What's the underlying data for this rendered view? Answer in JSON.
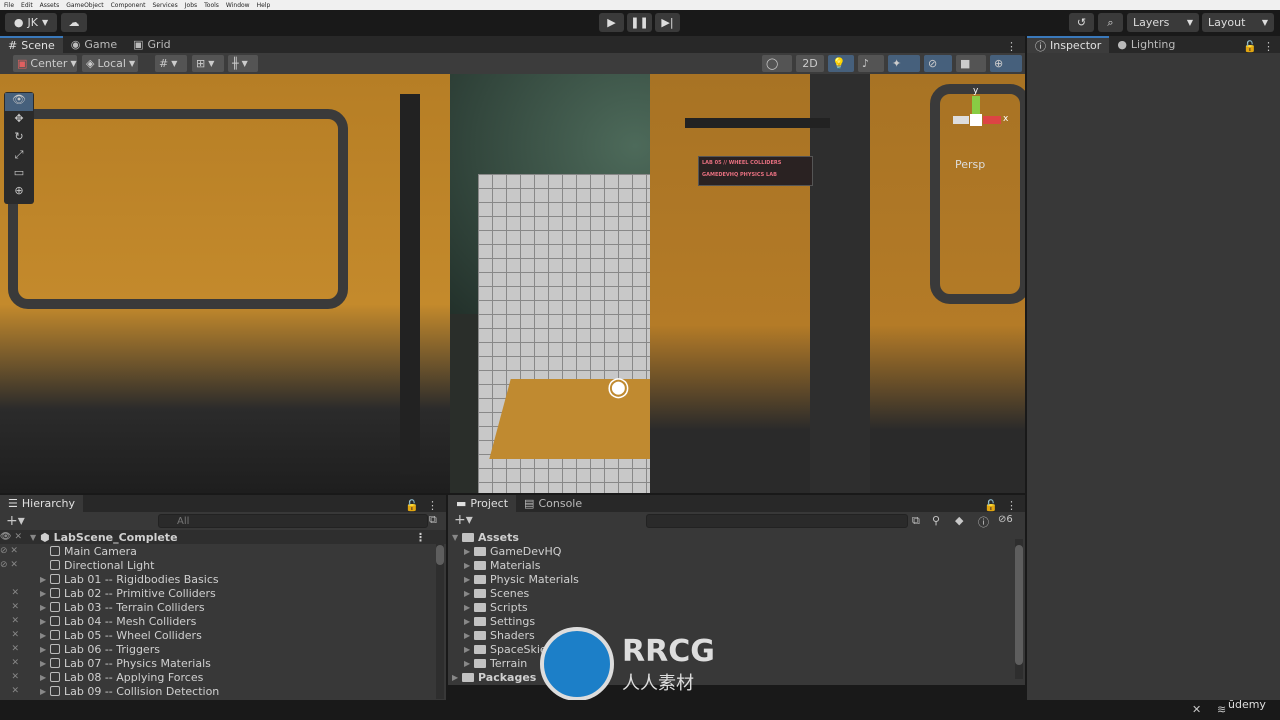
{
  "menu": [
    "File",
    "Edit",
    "Assets",
    "GameObject",
    "Component",
    "Services",
    "Jobs",
    "Tools",
    "Window",
    "Help"
  ],
  "toolbar": {
    "account": "JK",
    "cloud_icon": "cloud-icon",
    "play_icon": "play-icon",
    "pause_icon": "pause-icon",
    "step_icon": "step-icon",
    "history_icon": "history-icon",
    "search_icon": "search-icon",
    "layers": "Layers",
    "layout": "Layout"
  },
  "scene_tabs": [
    {
      "label": "Scene",
      "icon": "grid-icon"
    },
    {
      "label": "Game",
      "icon": "gamepad-icon"
    },
    {
      "label": "Grid",
      "icon": "grid-palette-icon"
    }
  ],
  "scene_toolbar": {
    "pivot": "Center",
    "space": "Local",
    "mode_2d": "2D"
  },
  "scene_view": {
    "sign_line1": "LAB 05 // WHEEL COLLIDERS",
    "sign_line2": "GAMEDEVHQ PHYSICS LAB",
    "gizmo_y": "y",
    "gizmo_x": "x",
    "projection": "Persp"
  },
  "inspector_tabs": [
    {
      "label": "Inspector",
      "icon": "info-icon"
    },
    {
      "label": "Lighting",
      "icon": "bulb-icon"
    }
  ],
  "hierarchy": {
    "title": "Hierarchy",
    "search_placeholder": "All",
    "scene": "LabScene_Complete",
    "items": [
      "Main Camera",
      "Directional Light",
      "Lab 01 -- Rigidbodies Basics",
      "Lab 02 -- Primitive Colliders",
      "Lab 03 -- Terrain Colliders",
      "Lab 04 -- Mesh Colliders",
      "Lab 05 -- Wheel Colliders",
      "Lab 06 -- Triggers",
      "Lab 07 -- Physics Materials",
      "Lab 08 -- Applying Forces",
      "Lab 09 -- Collision Detection"
    ]
  },
  "project": {
    "tabs": [
      "Project",
      "Console"
    ],
    "root": "Assets",
    "folders": [
      "GameDevHQ",
      "Materials",
      "Physic Materials",
      "Scenes",
      "Scripts",
      "Settings",
      "Shaders",
      "SpaceSkies",
      "Terrain"
    ],
    "packages": "Packages",
    "hidden_count": "6"
  },
  "watermark": {
    "brand": "RRCG",
    "sub": "人人素材",
    "udemy": "ūdemy"
  }
}
